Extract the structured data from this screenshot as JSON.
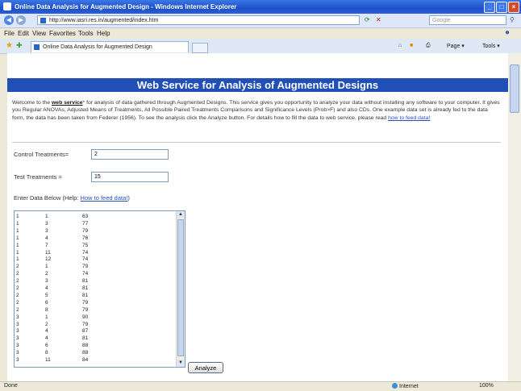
{
  "window": {
    "title": "Online Data Analysis for Augmented Design - Windows Internet Explorer",
    "buttons": {
      "minimize": "_",
      "maximize": "□",
      "close": "×"
    }
  },
  "addressbar": {
    "url": "http://www.iasri.res.in/augmented/index.htm",
    "search_placeholder": "Google",
    "back_icon": "back-arrow-icon",
    "forward_icon": "forward-arrow-icon"
  },
  "menu": {
    "items": [
      "File",
      "Edit",
      "View",
      "Favorites",
      "Tools",
      "Help"
    ]
  },
  "tabs": {
    "active_title": "Online Data Analysis for Augmented Design",
    "commands": {
      "page": "Page ▾",
      "tools": "Tools ▾"
    }
  },
  "page": {
    "banner": "Web Service for Analysis of Augmented Designs",
    "intro": {
      "prefix": "Welcome to the ",
      "link_bold": "web service",
      "body": "* for analysis of data gathered through Augmented Designs. This service gives you opportunity to analyze your data without installing any software to your computer. It gives you Regular ANOVAs, Adjusted Means of Treatments, All Possible Paired Treatments Comparisons and Significance Levels (Prob>F) and also CDs. One example data set is already fed to the data form, the data has been taken from Federer (1956). To see the analysis click the Analyze button. For details how to fill the data to web service, please read ",
      "read_link": "how to feed data!"
    },
    "form": {
      "control_label": "Control Treatments=",
      "control_value": "2",
      "test_label": "Test Treatments  =",
      "test_value": "15",
      "enter_label": "Enter Data Below (Help:",
      "help_link": "How to feed data!",
      "help_close": ")",
      "analyze_label": "Analyze"
    },
    "data_rows": [
      [
        "1",
        "1",
        "63"
      ],
      [
        "1",
        "3",
        "77"
      ],
      [
        "1",
        "3",
        "79"
      ],
      [
        "1",
        "4",
        "76"
      ],
      [
        "1",
        "7",
        "75"
      ],
      [
        "1",
        "11",
        "74"
      ],
      [
        "1",
        "12",
        "74"
      ],
      [
        "2",
        "1",
        "79"
      ],
      [
        "2",
        "2",
        "74"
      ],
      [
        "2",
        "3",
        "81"
      ],
      [
        "2",
        "4",
        "81"
      ],
      [
        "2",
        "5",
        "81"
      ],
      [
        "2",
        "6",
        "79"
      ],
      [
        "2",
        "8",
        "79"
      ],
      [
        "3",
        "1",
        "90"
      ],
      [
        "3",
        "2",
        "79"
      ],
      [
        "3",
        "4",
        "87"
      ],
      [
        "3",
        "4",
        "81"
      ],
      [
        "3",
        "6",
        "88"
      ],
      [
        "3",
        "8",
        "88"
      ],
      [
        "3",
        "11",
        "84"
      ]
    ]
  },
  "status": {
    "left": "Done",
    "zone": "Internet",
    "zoom": "100%"
  }
}
